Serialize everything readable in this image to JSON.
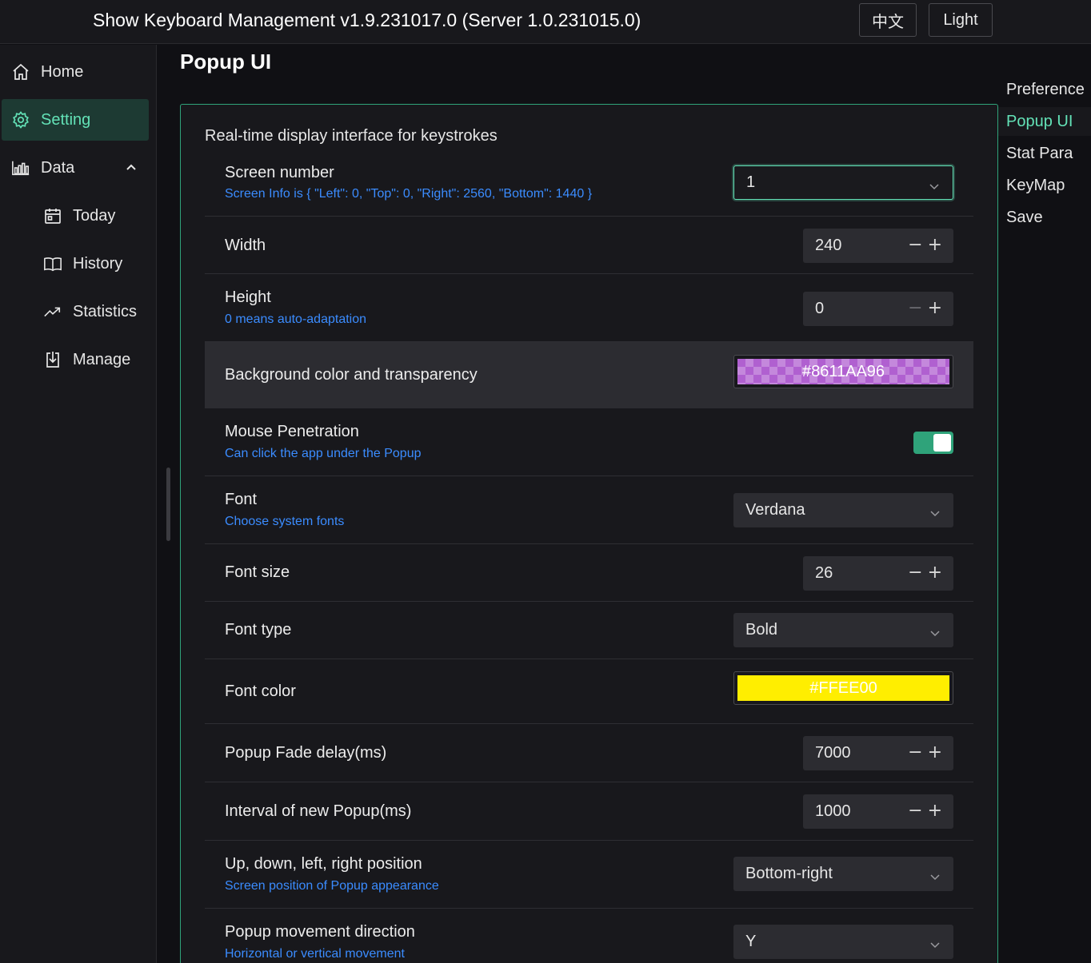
{
  "header": {
    "title": "Show Keyboard Management v1.9.231017.0 (Server 1.0.231015.0)",
    "lang_button": "中文",
    "theme_button": "Light"
  },
  "sidebar": {
    "items": [
      {
        "label": "Home",
        "icon": "home-icon"
      },
      {
        "label": "Setting",
        "icon": "gear-icon",
        "active": true
      },
      {
        "label": "Data",
        "icon": "bar-chart-icon",
        "expanded": true
      },
      {
        "label": "Today",
        "icon": "calendar-icon"
      },
      {
        "label": "History",
        "icon": "book-icon"
      },
      {
        "label": "Statistics",
        "icon": "trend-icon"
      },
      {
        "label": "Manage",
        "icon": "download-icon"
      }
    ]
  },
  "main": {
    "page_title": "Popup UI",
    "panel_desc": "Real-time display interface for keystrokes",
    "rows": {
      "screen_number": {
        "label": "Screen number",
        "sub": "Screen Info is { \"Left\": 0, \"Top\": 0, \"Right\": 2560, \"Bottom\": 1440 }",
        "value": "1"
      },
      "width": {
        "label": "Width",
        "value": "240"
      },
      "height": {
        "label": "Height",
        "sub": "0 means auto-adaptation",
        "value": "0"
      },
      "bg_color": {
        "label": "Background color and transparency",
        "value": "#8611AA96"
      },
      "mouse_pen": {
        "label": "Mouse Penetration",
        "sub": "Can click the app under the Popup",
        "on": true
      },
      "font": {
        "label": "Font",
        "sub": "Choose system fonts",
        "value": "Verdana"
      },
      "font_size": {
        "label": "Font size",
        "value": "26"
      },
      "font_type": {
        "label": "Font type",
        "value": "Bold"
      },
      "font_color": {
        "label": "Font color",
        "value": "#FFEE00"
      },
      "fade_delay": {
        "label": "Popup Fade delay(ms)",
        "value": "7000"
      },
      "interval": {
        "label": "Interval of new Popup(ms)",
        "value": "1000"
      },
      "position": {
        "label": "Up, down, left, right position",
        "sub": "Screen position of Popup appearance",
        "value": "Bottom-right"
      },
      "direction": {
        "label": "Popup movement direction",
        "sub": "Horizontal or vertical movement",
        "value": "Y"
      }
    }
  },
  "anchor": {
    "items": [
      "Preference",
      "Popup UI",
      "Stat Para",
      "KeyMap",
      "Save"
    ],
    "active": "Popup UI"
  },
  "colors": {
    "accent": "#63e2b7",
    "link": "#3b8cff",
    "background": "#101014",
    "surface": "#18181c"
  }
}
